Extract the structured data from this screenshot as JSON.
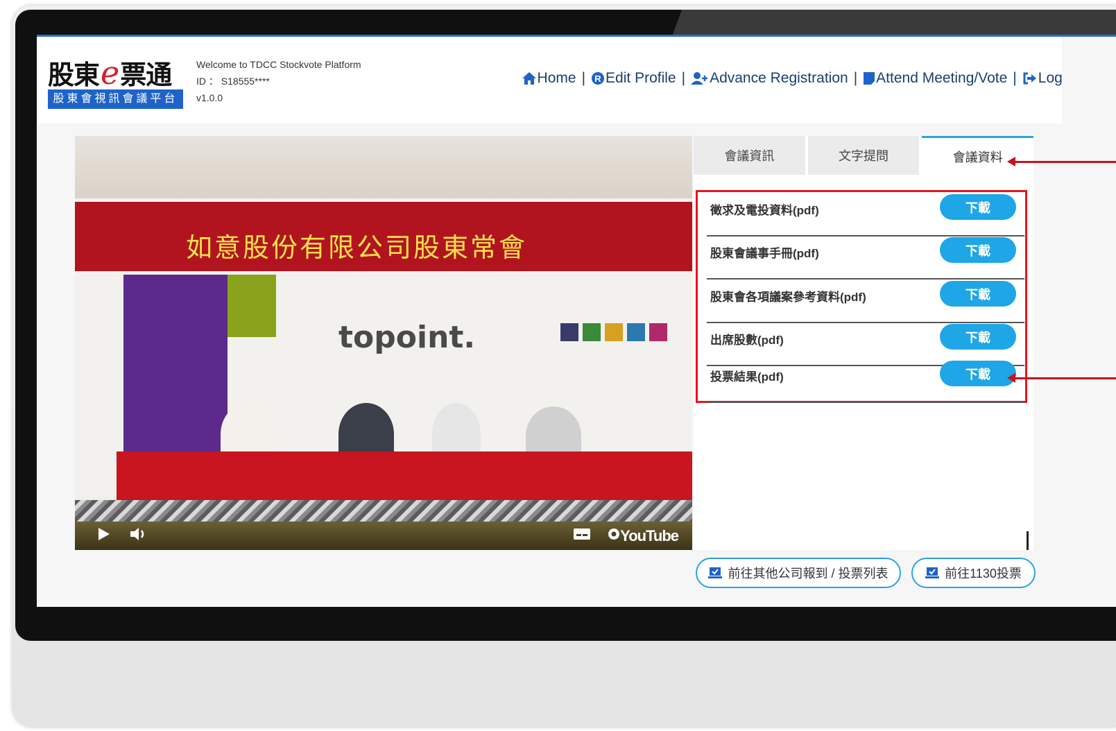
{
  "header": {
    "logo_title_a": "股東",
    "logo_title_e": "e",
    "logo_title_b": "票通",
    "logo_subtitle": "股東會視訊會議平台",
    "welcome": "Welcome to TDCC Stockvote Platform",
    "id_line": "ID ： S18555****",
    "version": "v1.0.0"
  },
  "nav": {
    "home": "Home",
    "edit_profile": "Edit Profile",
    "advance_registration": "Advance Registration",
    "attend_meeting": "Attend Meeting/Vote",
    "logout": "Logout",
    "separator": "|"
  },
  "video": {
    "banner_title": "如意股份有限公司股東常會",
    "room_logo": "topoint.",
    "player_brand": "YouTube"
  },
  "tabs": [
    {
      "label": "會議資訊",
      "active": false
    },
    {
      "label": "文字提問",
      "active": false
    },
    {
      "label": "會議資料",
      "active": true
    }
  ],
  "documents": [
    {
      "label": "徵求及電投資料(pdf)",
      "button": "下載"
    },
    {
      "label": "股東會議事手冊(pdf)",
      "button": "下載"
    },
    {
      "label": "股東會各項議案參考資料(pdf)",
      "button": "下載"
    },
    {
      "label": "出席股數(pdf)",
      "button": "下載"
    },
    {
      "label": "投票結果(pdf)",
      "button": "下載"
    }
  ],
  "actions": {
    "other_company": "前往其他公司報到 / 投票列表",
    "vote_1130": "前往1130投票"
  },
  "colors": {
    "accent_blue": "#1ea6e6",
    "highlight_red": "#e8141c",
    "logo_blue": "#1e63c8"
  }
}
